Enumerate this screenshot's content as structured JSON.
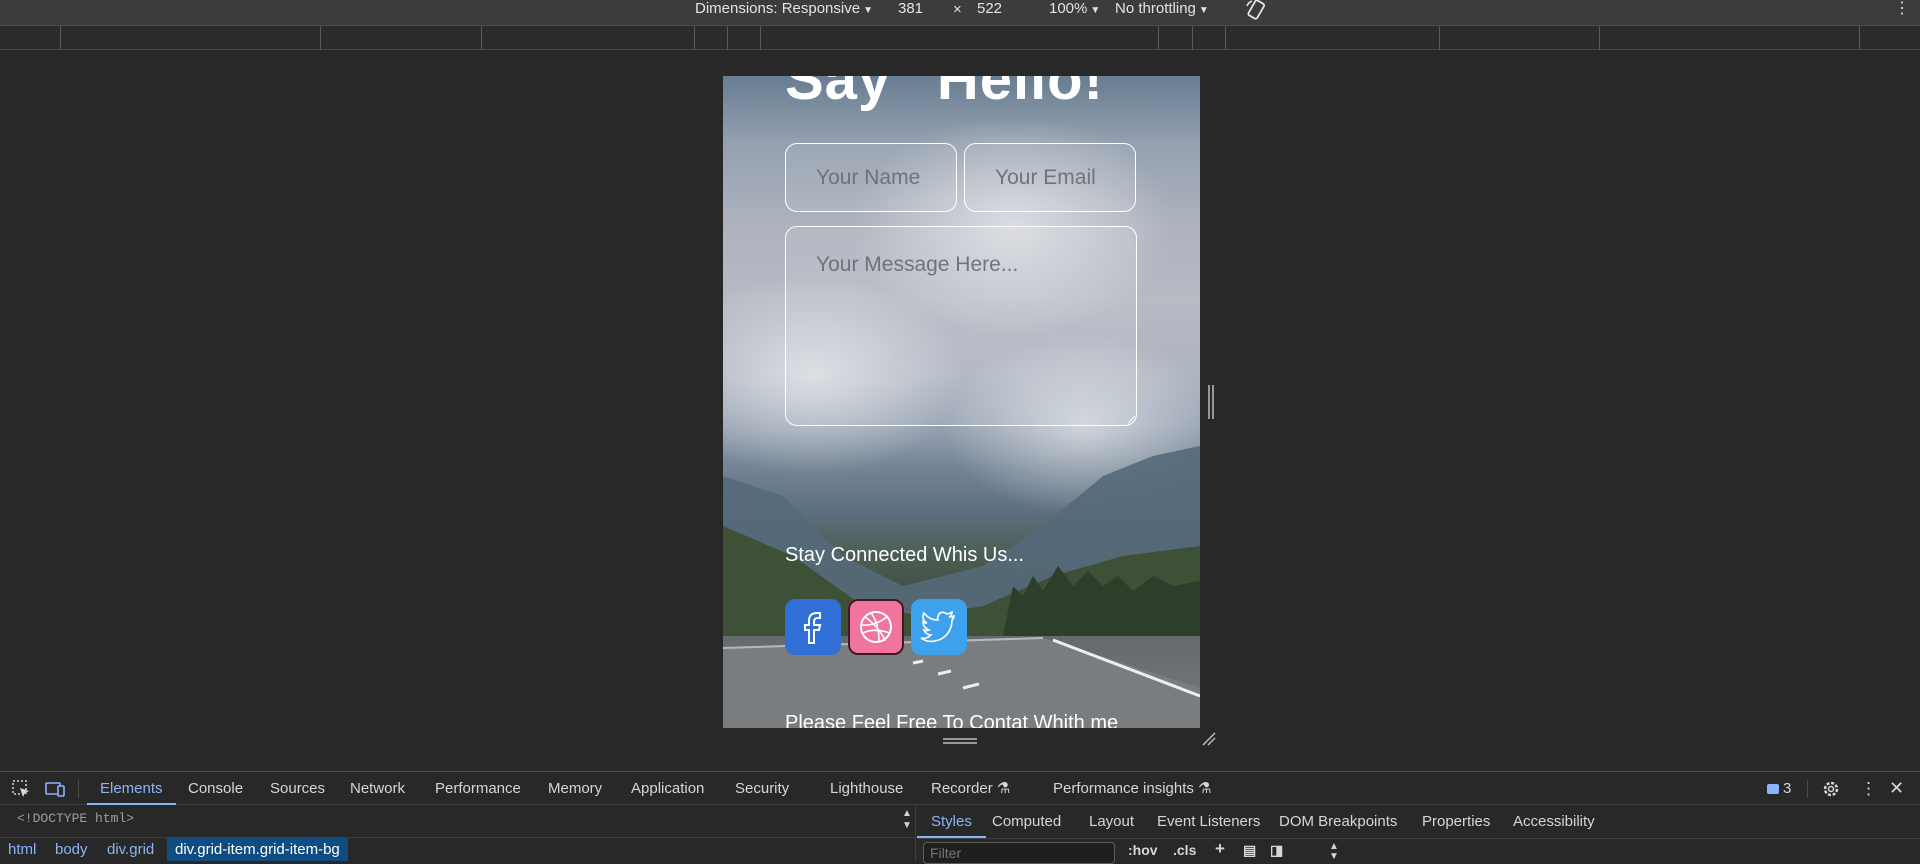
{
  "device_toolbar": {
    "dimensions_label": "Dimensions: Responsive",
    "width": "381",
    "times": "×",
    "height": "522",
    "zoom": "100%",
    "throttling": "No throttling",
    "rotate_icon": "rotate-icon",
    "more_icon": "kebab-icon"
  },
  "page": {
    "title": "Say \"Hello!\"",
    "name_placeholder": "Your Name",
    "email_placeholder": "Your Email",
    "message_placeholder": "Your Message Here...",
    "connect_text": "Stay Connected Whis Us...",
    "footer_text": "Please Feel Free To Contat Whith me",
    "social": [
      {
        "name": "facebook",
        "color": "#2f6fd6"
      },
      {
        "name": "dribbble",
        "color": "#f1749e"
      },
      {
        "name": "twitter",
        "color": "#3ea1ec"
      }
    ]
  },
  "devtools": {
    "tabs": [
      "Elements",
      "Console",
      "Sources",
      "Network",
      "Performance",
      "Memory",
      "Application",
      "Security",
      "Lighthouse",
      "Recorder",
      "Performance insights"
    ],
    "active_tab": "Elements",
    "issues_count": "3",
    "doctype": "<!DOCTYPE html>",
    "breadcrumbs": [
      "html",
      "body",
      "div.grid",
      "div.grid-item.grid-item-bg"
    ],
    "side_tabs": [
      "Styles",
      "Computed",
      "Layout",
      "Event Listeners",
      "DOM Breakpoints",
      "Properties",
      "Accessibility"
    ],
    "filter_placeholder": "Filter",
    "hov_label": ":hov",
    "cls_label": ".cls",
    "accent": "#8ab4f8"
  }
}
